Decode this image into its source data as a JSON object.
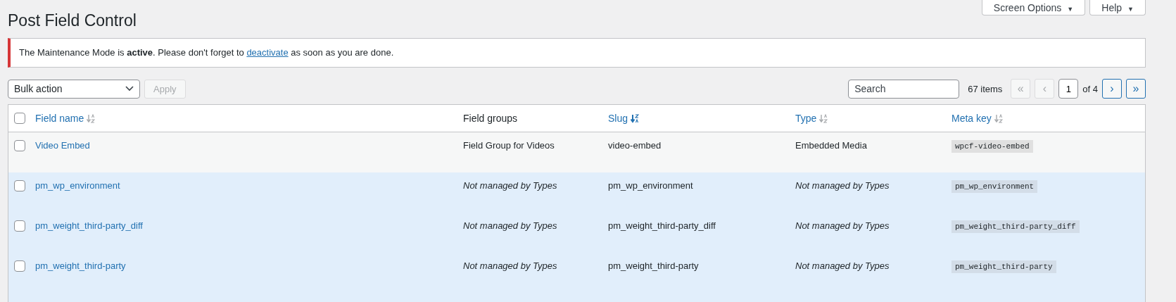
{
  "screen_meta": [
    {
      "label": "Screen Options",
      "caret": "▼"
    },
    {
      "label": "Help",
      "caret": "▼"
    }
  ],
  "page_title": "Post Field Control",
  "notice": {
    "text": "The Maintenance Mode is **active**. Please don't forget to ",
    "link": "deactivate",
    "after": " as soon as you are done."
  },
  "bulk_action": {
    "value": "Bulk action"
  },
  "apply_button": {
    "label": "Apply",
    "disabled": true
  },
  "search": {
    "placeholder": "Search"
  },
  "pagination": {
    "count": "67 items",
    "buttons": [
      {
        "label": "«",
        "disabled": true
      },
      {
        "label": "‹",
        "disabled": true
      }
    ],
    "page": "1",
    "total": "of 4",
    "next_buttons": [
      {
        "label": "›",
        "disabled": false
      },
      {
        "label": "»",
        "disabled": false
      }
    ]
  },
  "table": {
    "select_all": {
      "checked": false
    },
    "columns": [
      {
        "label": "Field name",
        "sortable": true,
        "sorted": false
      },
      {
        "label": "Field groups",
        "sortable": false,
        "sorted": false
      },
      {
        "label": "Slug",
        "sortable": true,
        "sorted": true
      },
      {
        "label": "Type",
        "sortable": true,
        "sorted": false
      },
      {
        "label": "Meta key",
        "sortable": true,
        "sorted": false
      }
    ],
    "rows": [
      {
        "kind": "managed",
        "checked": false,
        "name": "Video Embed",
        "group": "Field Group for Videos",
        "slug": "video-embed",
        "type": "Embedded Media",
        "meta_key": "wpcf-video-embed"
      },
      {
        "kind": "unmanaged",
        "checked": false,
        "name": "pm_wp_environment",
        "group": "Not managed by Types",
        "slug": "pm_wp_environment",
        "type": "Not managed by Types",
        "meta_key": "pm_wp_environment"
      },
      {
        "kind": "unmanaged",
        "checked": false,
        "name": "pm_weight_third-party_diff",
        "group": "Not managed by Types",
        "slug": "pm_weight_third-party_diff",
        "type": "Not managed by Types",
        "meta_key": "pm_weight_third-party_diff"
      },
      {
        "kind": "unmanaged",
        "checked": false,
        "name": "pm_weight_third-party",
        "group": "Not managed by Types",
        "slug": "pm_weight_third-party",
        "type": "Not managed by Types",
        "meta_key": "pm_weight_third-party"
      }
    ]
  }
}
